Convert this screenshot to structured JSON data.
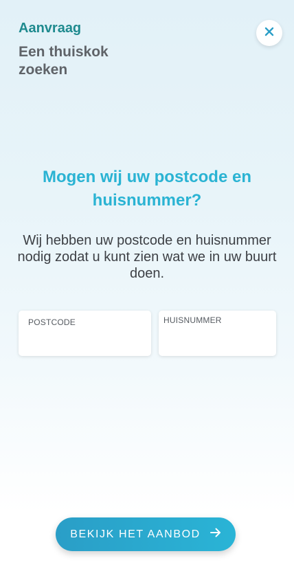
{
  "header": {
    "kicker": "Aanvraag",
    "title": "Een thuiskok zoeken",
    "close_icon": "close-icon"
  },
  "main": {
    "headline": "Mogen wij uw postcode en huisnummer?",
    "description": "Wij hebben uw postcode en huisnummer nodig zodat u kunt zien wat we in uw buurt doen."
  },
  "form": {
    "postcode": {
      "label": "POSTCODE",
      "value": ""
    },
    "huisnummer": {
      "label": "HUISNUMMER",
      "value": ""
    }
  },
  "cta": {
    "label": "BEKIJK HET AANBOD",
    "icon": "arrow-right-icon"
  },
  "colors": {
    "accent": "#2ab3d3",
    "kicker": "#1e8a8e",
    "title": "#5f6368"
  }
}
